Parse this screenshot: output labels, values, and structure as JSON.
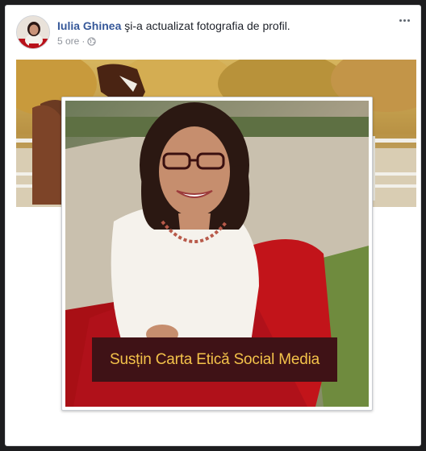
{
  "post": {
    "author_name": "Iulia Ghinea",
    "action_text": " şi-a actualizat fotografia de profil.",
    "timestamp": "5 ore",
    "separator": "·",
    "privacy_icon": "globe-icon",
    "more_icon": "more-options-icon"
  },
  "profile_frame": {
    "banner_text": "Susțin Carta Etică Social Media"
  },
  "colors": {
    "name_link": "#365899",
    "meta_text": "#90949c",
    "banner_bg": "#3f1216",
    "banner_text": "#f3c24a"
  }
}
